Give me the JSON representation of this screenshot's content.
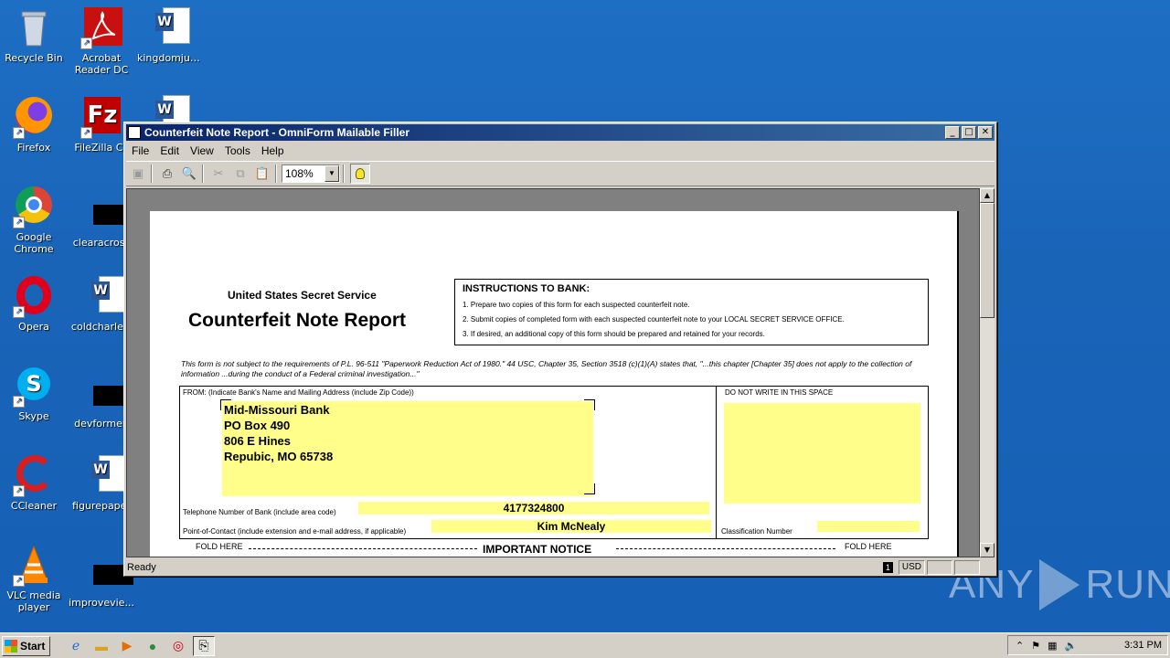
{
  "desktop": {
    "icons": [
      {
        "label": "Recycle Bin",
        "icon": "recycle-bin-icon"
      },
      {
        "label": "Acrobat Reader DC",
        "label2": "Reader DC",
        "label1": "Acrobat",
        "icon": "acrobat-icon"
      },
      {
        "label": "kingdomjust...",
        "icon": "word-document-icon"
      },
      {
        "label": "Firefox",
        "icon": "firefox-icon"
      },
      {
        "label": "FileZilla Cli",
        "icon": "filezilla-icon"
      },
      {
        "label": "Google Chrome",
        "label1": "Google",
        "label2": "Chrome",
        "icon": "chrome-icon"
      },
      {
        "label": "clearacross",
        "icon": "redacted-icon"
      },
      {
        "label": "Opera",
        "icon": "opera-icon"
      },
      {
        "label": "coldcharles.",
        "icon": "word-document-icon"
      },
      {
        "label": "Skype",
        "icon": "skype-icon"
      },
      {
        "label": "devformer.",
        "icon": "redacted-icon"
      },
      {
        "label": "CCleaner",
        "icon": "ccleaner-icon"
      },
      {
        "label": "figurepaper",
        "icon": "word-document-icon"
      },
      {
        "label": "VLC media player",
        "label1": "VLC media",
        "label2": "player",
        "icon": "vlc-icon"
      },
      {
        "label": "improvevie...",
        "icon": "redacted-icon"
      }
    ]
  },
  "window": {
    "title": "Counterfeit Note Report - OmniForm Mailable Filler",
    "menu": [
      "File",
      "Edit",
      "View",
      "Tools",
      "Help"
    ],
    "zoom": "108%",
    "status": "Ready",
    "status_page": "1",
    "status_currency": "USD"
  },
  "form": {
    "agency": "United States Secret Service",
    "title": "Counterfeit Note Report",
    "instructions_heading": "INSTRUCTIONS TO BANK:",
    "instructions": [
      "1. Prepare two copies of this form for each suspected counterfeit note.",
      "2. Submit copies of completed form with each suspected counterfeit note to your LOCAL SECRET SERVICE OFFICE.",
      "3. If desired, an additional copy of this form should be prepared and retained for your records."
    ],
    "disclaimer": "This form is not subject to the requirements of P.L. 96-511 \"Paperwork Reduction Act of 1980.\" 44 USC, Chapter 35, Section 3518 (c)(1)(A) states that, \"...this chapter [Chapter 35] does not apply to the collection of information ...during the conduct of a Federal criminal investigation...\"",
    "from_label": "FROM: (Indicate Bank's Name and Mailing Address (include Zip Code))",
    "address_lines": [
      "Mid-Missouri Bank",
      "PO Box 490",
      "806 E Hines",
      "Repubic, MO  65738"
    ],
    "phone_label": "Telephone Number of Bank (include area code)",
    "phone": "4177324800",
    "contact_label": "Point-of-Contact (include extension and e-mail address, if applicable)",
    "contact": "Kim McNealy",
    "do_not_write": "DO NOT WRITE IN THIS SPACE",
    "classification_label": "Classification Number",
    "fold_left": "FOLD HERE",
    "fold_right": "FOLD HERE",
    "important_notice": "IMPORTANT NOTICE"
  },
  "taskbar": {
    "start": "Start",
    "clock": "3:31 PM"
  },
  "watermark": {
    "left": "ANY",
    "right": "RUN"
  }
}
